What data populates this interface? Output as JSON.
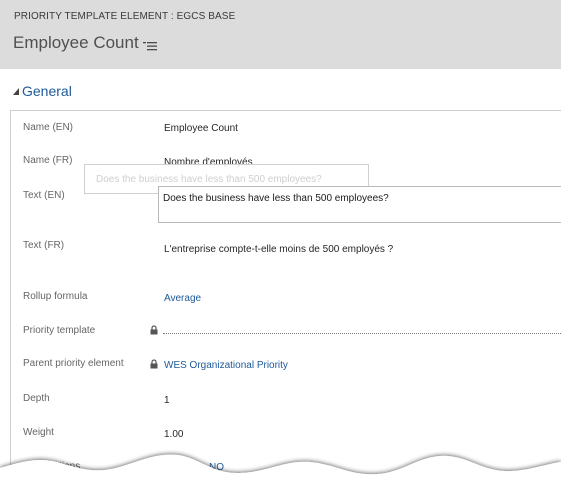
{
  "header": {
    "entity_type": "PRIORITY TEMPLATE ELEMENT : EGCS BASE",
    "record_title": "Employee Count",
    "menu_icon": "list-menu-icon"
  },
  "section": {
    "title": "General",
    "toggle_icon": "collapse-triangle-icon"
  },
  "tooltip": {
    "text": "Does the business have less than 500 employees?"
  },
  "fields": {
    "name_en": {
      "label": "Name (EN)",
      "value": "Employee Count"
    },
    "name_fr": {
      "label": "Name (FR)",
      "value": "Nombre d'employés"
    },
    "text_en": {
      "label": "Text (EN)",
      "value": "Does the business have less than 500 employees?"
    },
    "text_fr": {
      "label": "Text (FR)",
      "value": "L'entreprise compte-t-elle moins de 500 employés ?"
    },
    "rollup_formula": {
      "label": "Rollup formula",
      "value": "Average"
    },
    "priority_template": {
      "label": "Priority template",
      "value": ""
    },
    "parent_priority_element": {
      "label": "Parent priority element",
      "value": "WES Organizational Priority"
    },
    "depth": {
      "label": "Depth",
      "value": "1"
    },
    "weight": {
      "label": "Weight",
      "value": "1.00"
    },
    "options": {
      "label": "options",
      "value": "NO"
    }
  },
  "colors": {
    "header_bg": "#dcdcdc",
    "link": "#1e5a9a",
    "label": "#666666"
  }
}
